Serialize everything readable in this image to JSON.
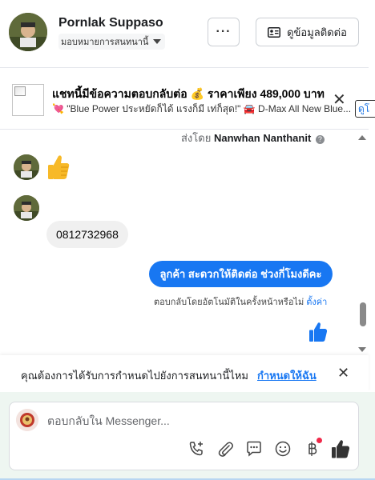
{
  "header": {
    "contact_name": "Pornlak Suppaso",
    "assign_label": "มอบหมายการสนทนานี้",
    "more_label": "···",
    "contact_button_label": "ดูข้อมูลติดต่อ"
  },
  "banner": {
    "title": "แชทนี้มีข้อความตอบกลับต่อ 💰 ราคาเพียง 489,000 บาท",
    "subtitle": "💘 \"Blue Power ประหยัดก็ได้ แรงก็มี เท่ก็สุด!\" 🚘 D-Max All New Blue...",
    "close_label": "✕",
    "cut_button_label": "ดูโ"
  },
  "messages": {
    "sent_by_prefix": "ส่งโดย",
    "sent_by_name": "Nanwhan Nanthanit",
    "info_label": "?",
    "incoming_phone": "0812732968",
    "outgoing_text": "ลูกค้า สะดวกให้ติดต่อ ช่วงกี่โมงดีคะ",
    "auto_reply_text": "ตอบกลับโดยอัตโนมัติในครั้งหน้าหรือไม่",
    "auto_reply_link": "ตั้งค่า"
  },
  "assign_bar": {
    "question": "คุณต้องการได้รับการกำหนดไปยังการสนทนานี้ไหม",
    "link": "กำหนดให้ฉัน",
    "close_label": "✕"
  },
  "composer": {
    "placeholder": "ตอบกลับใน Messenger..."
  },
  "colors": {
    "accent": "#1877f2",
    "notification": "#f02849"
  }
}
